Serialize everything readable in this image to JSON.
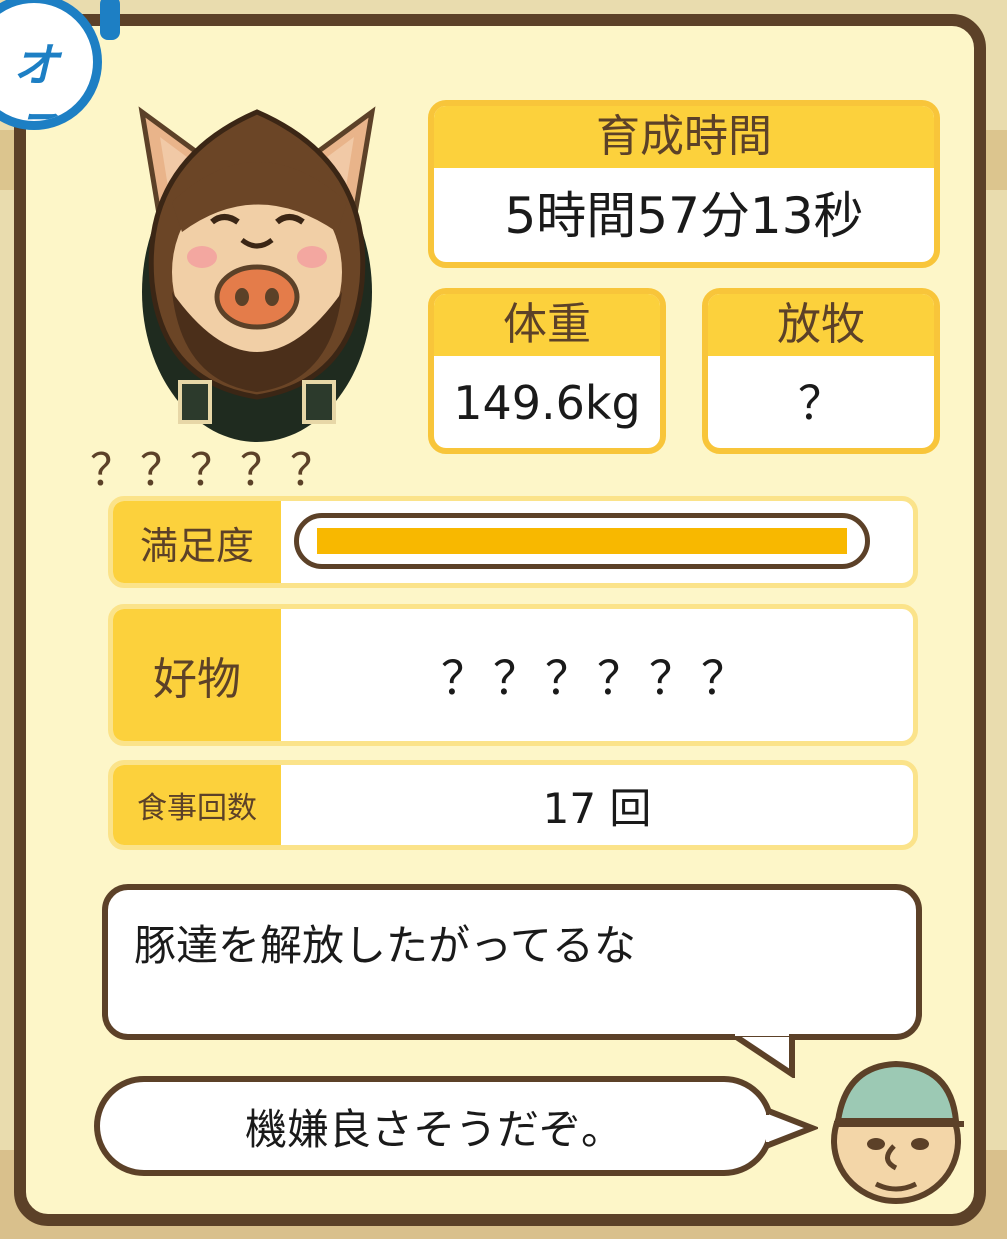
{
  "sex_badge": "オス",
  "pig_name": "？？？？？",
  "growth_time": {
    "label": "育成時間",
    "value": "5時間57分13秒"
  },
  "weight": {
    "label": "体重",
    "value": "149.6kg"
  },
  "pasture": {
    "label": "放牧",
    "value": "？"
  },
  "satisfaction": {
    "label": "満足度",
    "fraction": 1.0
  },
  "favorite_food": {
    "label": "好物",
    "value": "？？？？？？"
  },
  "meal_count": {
    "label": "食事回数",
    "value": "17 回"
  },
  "pig_comment": "豚達を解放したがってるな",
  "farmer_comment": "機嫌良さそうだぞ。",
  "colors": {
    "frame_brown": "#5c4128",
    "card_cream": "#fdf6c8",
    "accent_yellow": "#fcd13c",
    "gauge_fill": "#f8b800",
    "badge_blue": "#1d7fc4"
  }
}
